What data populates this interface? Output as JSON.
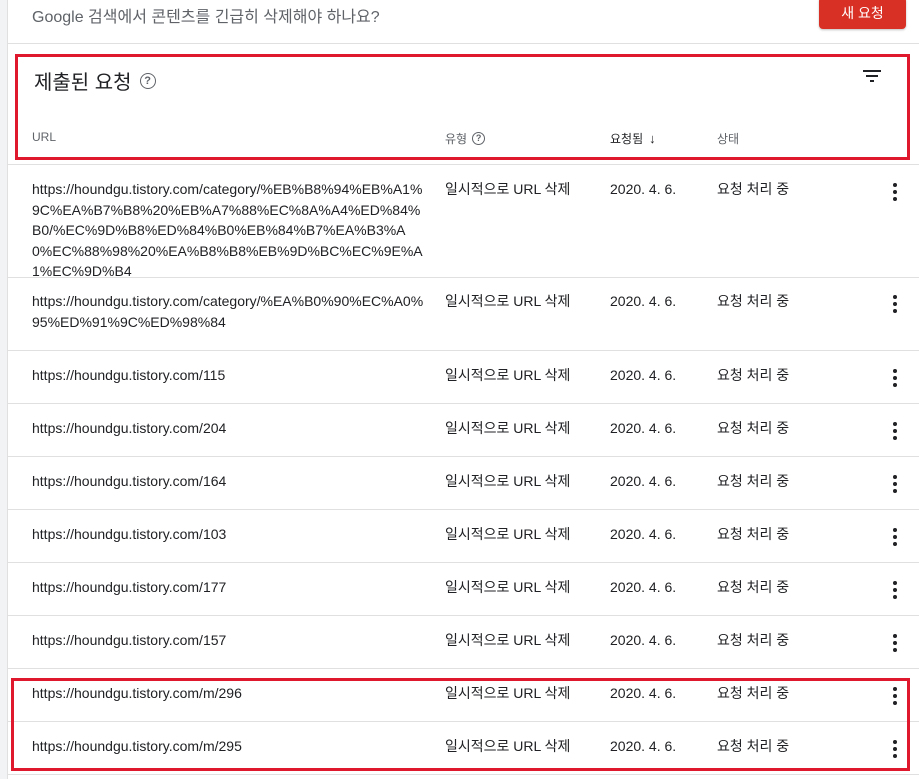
{
  "banner": {
    "prompt": "Google 검색에서 콘텐츠를 긴급히 삭제해야 하나요?",
    "new_request_label": "새 요청",
    "accent_color": "#d93025"
  },
  "section": {
    "title": "제출된 요청",
    "help_icon": "help-circle-icon",
    "filter_icon": "filter-icon"
  },
  "columns": {
    "url": "URL",
    "type": "유형",
    "requested": "요청됨",
    "status": "상태",
    "sort_icon": "arrow-down-icon"
  },
  "rows": [
    {
      "url": "https://houndgu.tistory.com/category/%EB%B8%94%EB%A1%9C%EA%B7%B8%20%EB%A7%88%EC%8A%A4%ED%84%B0/%EC%9D%B8%ED%84%B0%EB%84%B7%EA%B3%A0%EC%88%98%20%EA%B8%B8%EB%9D%BC%EC%9E%A1%EC%9D%B4",
      "type": "일시적으로 URL 삭제",
      "date": "2020. 4. 6.",
      "status": "요청 처리 중"
    },
    {
      "url": "https://houndgu.tistory.com/category/%EA%B0%90%EC%A0%95%ED%91%9C%ED%98%84",
      "type": "일시적으로 URL 삭제",
      "date": "2020. 4. 6.",
      "status": "요청 처리 중"
    },
    {
      "url": "https://houndgu.tistory.com/115",
      "type": "일시적으로 URL 삭제",
      "date": "2020. 4. 6.",
      "status": "요청 처리 중"
    },
    {
      "url": "https://houndgu.tistory.com/204",
      "type": "일시적으로 URL 삭제",
      "date": "2020. 4. 6.",
      "status": "요청 처리 중"
    },
    {
      "url": "https://houndgu.tistory.com/164",
      "type": "일시적으로 URL 삭제",
      "date": "2020. 4. 6.",
      "status": "요청 처리 중"
    },
    {
      "url": "https://houndgu.tistory.com/103",
      "type": "일시적으로 URL 삭제",
      "date": "2020. 4. 6.",
      "status": "요청 처리 중"
    },
    {
      "url": "https://houndgu.tistory.com/177",
      "type": "일시적으로 URL 삭제",
      "date": "2020. 4. 6.",
      "status": "요청 처리 중"
    },
    {
      "url": "https://houndgu.tistory.com/157",
      "type": "일시적으로 URL 삭제",
      "date": "2020. 4. 6.",
      "status": "요청 처리 중"
    },
    {
      "url": "https://houndgu.tistory.com/m/296",
      "type": "일시적으로 URL 삭제",
      "date": "2020. 4. 6.",
      "status": "요청 처리 중"
    },
    {
      "url": "https://houndgu.tistory.com/m/295",
      "type": "일시적으로 URL 삭제",
      "date": "2020. 4. 6.",
      "status": "요청 처리 중"
    }
  ],
  "row_menu_icon": "more-vert-icon",
  "annotation_color": "#e0182d"
}
